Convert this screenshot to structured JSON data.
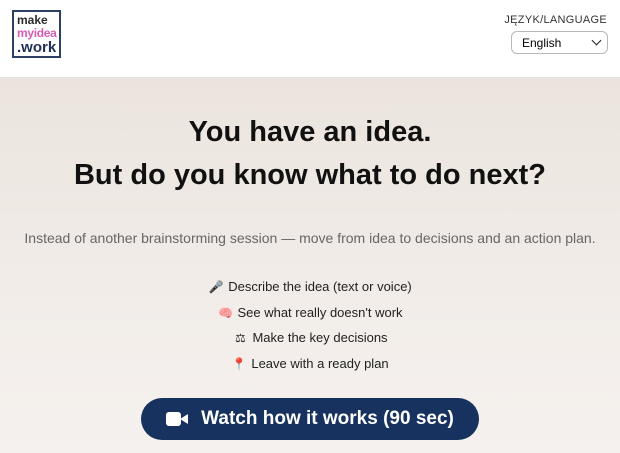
{
  "logo": {
    "line1": "make",
    "line2": "myidea",
    "line3": ".work"
  },
  "language": {
    "label": "JĘZYK/LANGUAGE",
    "selected": "English"
  },
  "hero": {
    "title_line1": "You have an idea.",
    "title_line2": "But do you know what to do next?",
    "subtitle": "Instead of another brainstorming session — move from idea to decisions and an action plan."
  },
  "features": [
    {
      "icon": "🎤",
      "icon_name": "microphone-icon",
      "text": "Describe the idea (text or voice)"
    },
    {
      "icon": "🧠",
      "icon_name": "brain-icon",
      "text": "See what really doesn't work"
    },
    {
      "icon": "⚖",
      "icon_name": "scales-icon",
      "text": "Make the key decisions"
    },
    {
      "icon": "📍",
      "icon_name": "pin-icon",
      "text": "Leave with a ready plan"
    }
  ],
  "cta": {
    "label": "Watch how it works (90 sec)",
    "icon_name": "video-camera-icon"
  },
  "colors": {
    "cta_bg": "#17325f",
    "logo_accent": "#d85bb2",
    "logo_dark": "#1f2f55"
  }
}
